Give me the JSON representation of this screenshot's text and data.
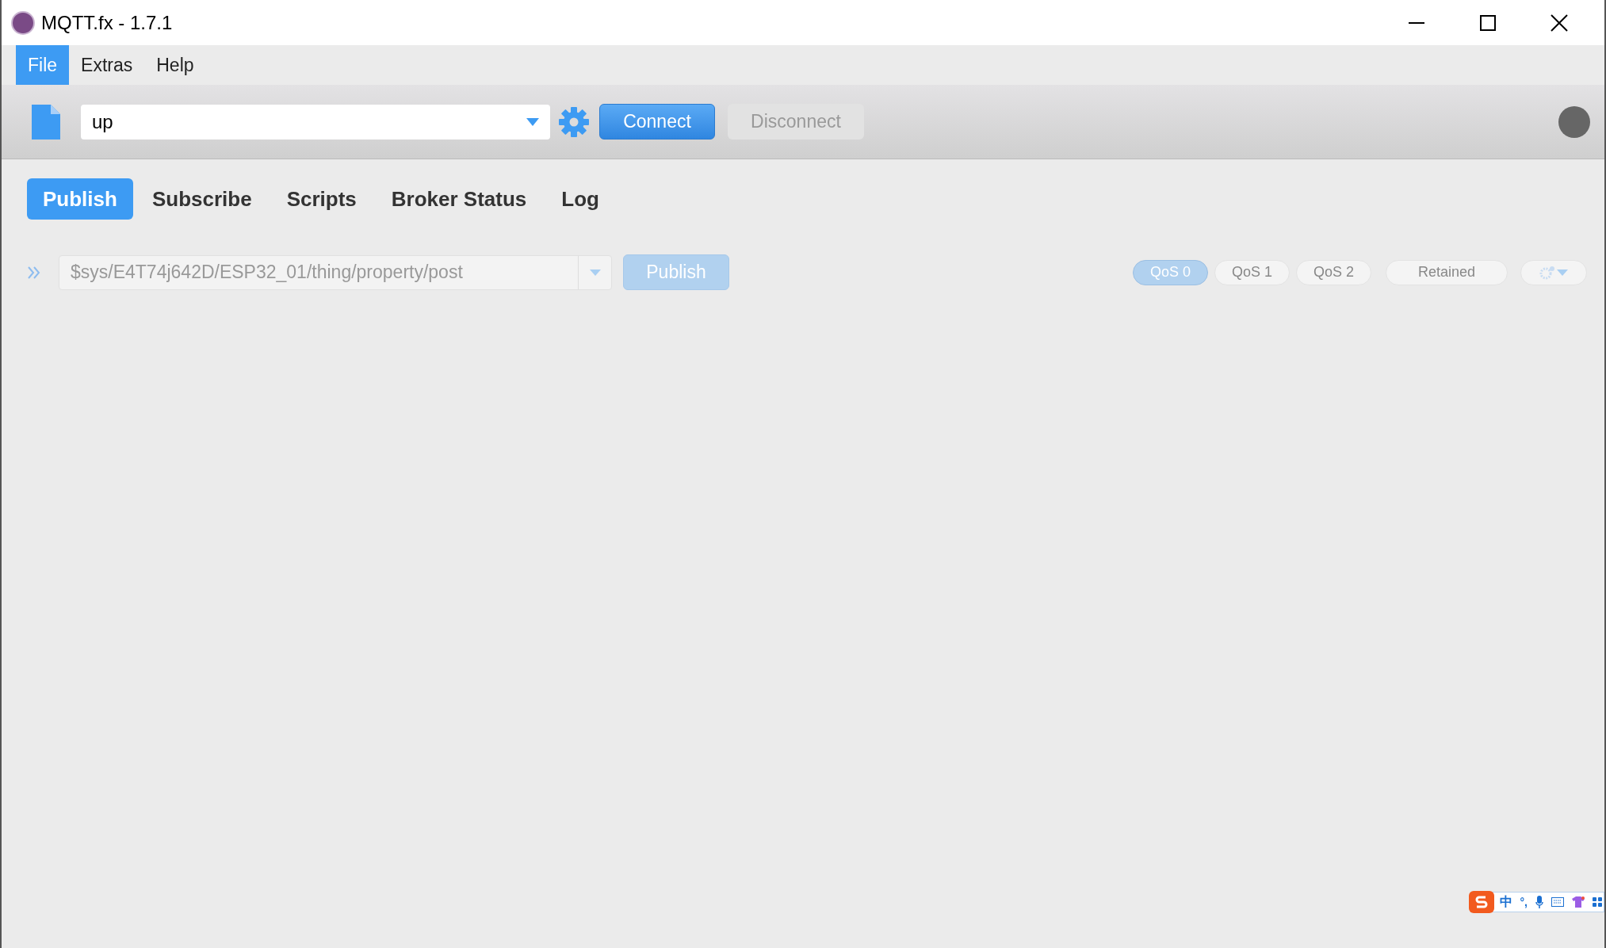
{
  "window": {
    "title": "MQTT.fx - 1.7.1"
  },
  "menu": [
    {
      "label": "File",
      "selected": true
    },
    {
      "label": "Extras",
      "selected": false
    },
    {
      "label": "Help",
      "selected": false
    }
  ],
  "toolbar": {
    "profile": "up",
    "connect": {
      "label": "Connect",
      "disabled": false
    },
    "disconnect": {
      "label": "Disconnect",
      "disabled": true
    },
    "connected": false
  },
  "tabs": [
    {
      "label": "Publish",
      "selected": true
    },
    {
      "label": "Subscribe",
      "selected": false
    },
    {
      "label": "Scripts",
      "selected": false
    },
    {
      "label": "Broker Status",
      "selected": false
    },
    {
      "label": "Log",
      "selected": false
    }
  ],
  "publish": {
    "topic": "$sys/E4T74j642D/ESP32_01/thing/property/post",
    "disabled": true,
    "button": "Publish",
    "qos": [
      {
        "label": "QoS 0",
        "selected": true
      },
      {
        "label": "QoS 1",
        "selected": false
      },
      {
        "label": "QoS 2",
        "selected": false
      }
    ],
    "retained": {
      "label": "Retained",
      "on": false
    }
  },
  "ime": {
    "mode": "中",
    "punctuation": "°,"
  }
}
